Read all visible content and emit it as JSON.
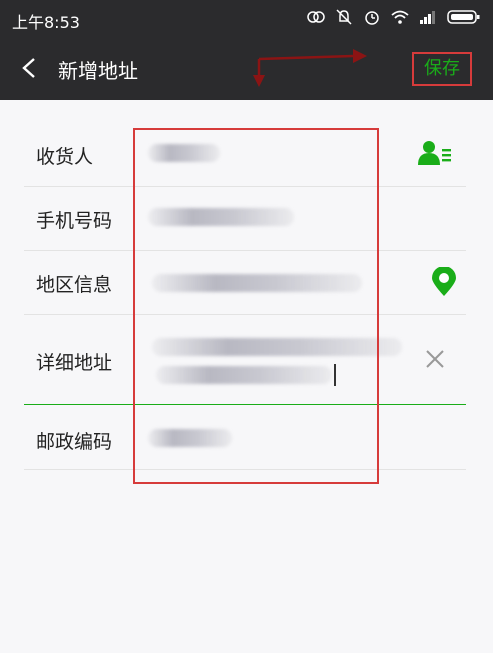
{
  "status_bar": {
    "time": "上午8:53",
    "icons": [
      "sync-icon",
      "mute-icon",
      "alarm-icon",
      "wifi-icon",
      "signal-icon",
      "battery-icon"
    ]
  },
  "navbar": {
    "title": "新增地址",
    "save_label": "保存"
  },
  "form": {
    "fields": [
      {
        "label": "收货人",
        "icon": "contact-book-icon"
      },
      {
        "label": "手机号码"
      },
      {
        "label": "地区信息",
        "icon": "location-pin-icon"
      },
      {
        "label": "详细地址",
        "icon": "clear-icon"
      },
      {
        "label": "邮政编码"
      }
    ]
  },
  "colors": {
    "accent": "#1aad19",
    "highlight": "#d63b3b",
    "bar": "#2b2b2d"
  }
}
